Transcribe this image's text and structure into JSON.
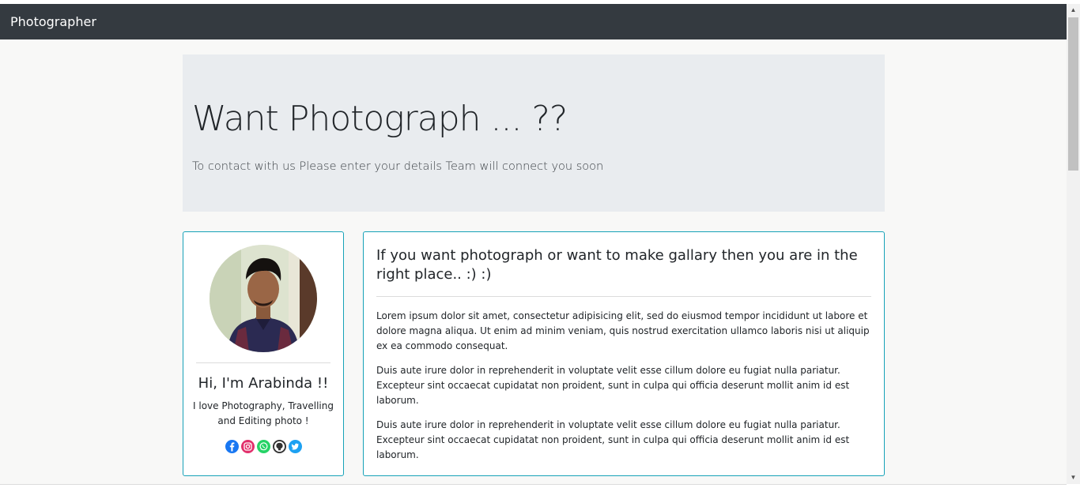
{
  "navbar": {
    "brand": "Photographer"
  },
  "jumbotron": {
    "title": "Want Photograph ... ??",
    "subtitle": "To contact with us Please enter your details Team will connect you soon"
  },
  "profile": {
    "name": "Hi, I'm Arabinda !!",
    "bio": "I love Photography, Travelling and Editing photo !",
    "socials": [
      "facebook-icon",
      "instagram-icon",
      "whatsapp-icon",
      "github-icon",
      "twitter-icon"
    ]
  },
  "about": {
    "title": "If you want photograph or want to make gallary then you are in the right place.. :) :)",
    "paragraphs": [
      "Lorem ipsum dolor sit amet, consectetur adipisicing elit, sed do eiusmod tempor incididunt ut labore et dolore magna aliqua. Ut enim ad minim veniam, quis nostrud exercitation ullamco laboris nisi ut aliquip ex ea commodo consequat.",
      "Duis aute irure dolor in reprehenderit in voluptate velit esse cillum dolore eu fugiat nulla pariatur. Excepteur sint occaecat cupidatat non proident, sunt in culpa qui officia deserunt mollit anim id est laborum.",
      "Duis aute irure dolor in reprehenderit in voluptate velit esse cillum dolore eu fugiat nulla pariatur. Excepteur sint occaecat cupidatat non proident, sunt in culpa qui officia deserunt mollit anim id est laborum."
    ]
  },
  "colors": {
    "navbar": "#343a40",
    "jumbotron": "#e9ecef",
    "card_border": "#17a2b8",
    "facebook": "#1877f2",
    "instagram": "#e1306c",
    "whatsapp": "#25d366",
    "github": "#333333",
    "twitter": "#1da1f2"
  }
}
